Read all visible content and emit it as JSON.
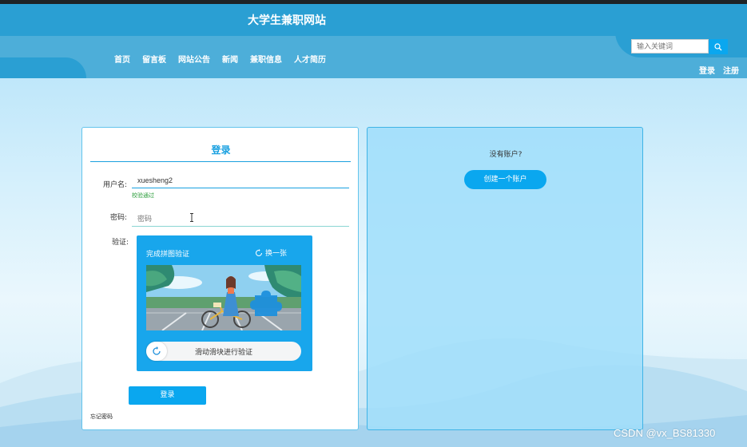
{
  "site": {
    "title": "大学生兼职网站"
  },
  "nav": {
    "items": [
      {
        "label": "首页"
      },
      {
        "label": "留言板"
      },
      {
        "label": "网站公告"
      },
      {
        "label": "新闻"
      },
      {
        "label": "兼职信息"
      },
      {
        "label": "人才简历"
      }
    ]
  },
  "search": {
    "placeholder": "输入关键词",
    "icon": "search-icon"
  },
  "auth": {
    "login": "登录",
    "register": "注册"
  },
  "login_form": {
    "title": "登录",
    "username_label": "用户名:",
    "username_value": "xuesheng2",
    "username_status": "校验通过",
    "password_label": "密码:",
    "password_placeholder": "密码",
    "captcha_label": "验证:",
    "captcha": {
      "title": "完成拼图验证",
      "refresh_label": "换一张",
      "slider_text": "滑动滑块进行验证",
      "slider_progress": 0
    },
    "submit_label": "登录",
    "forgot_label": "忘记密码"
  },
  "register_panel": {
    "question": "没有账户?",
    "create_button": "创建一个账户"
  },
  "watermark": "CSDN @vx_BS81330",
  "colors": {
    "primary": "#0aa7ef",
    "header": "#2a9fd3",
    "nav": "#4daed9",
    "valid": "#2a9d3a"
  }
}
